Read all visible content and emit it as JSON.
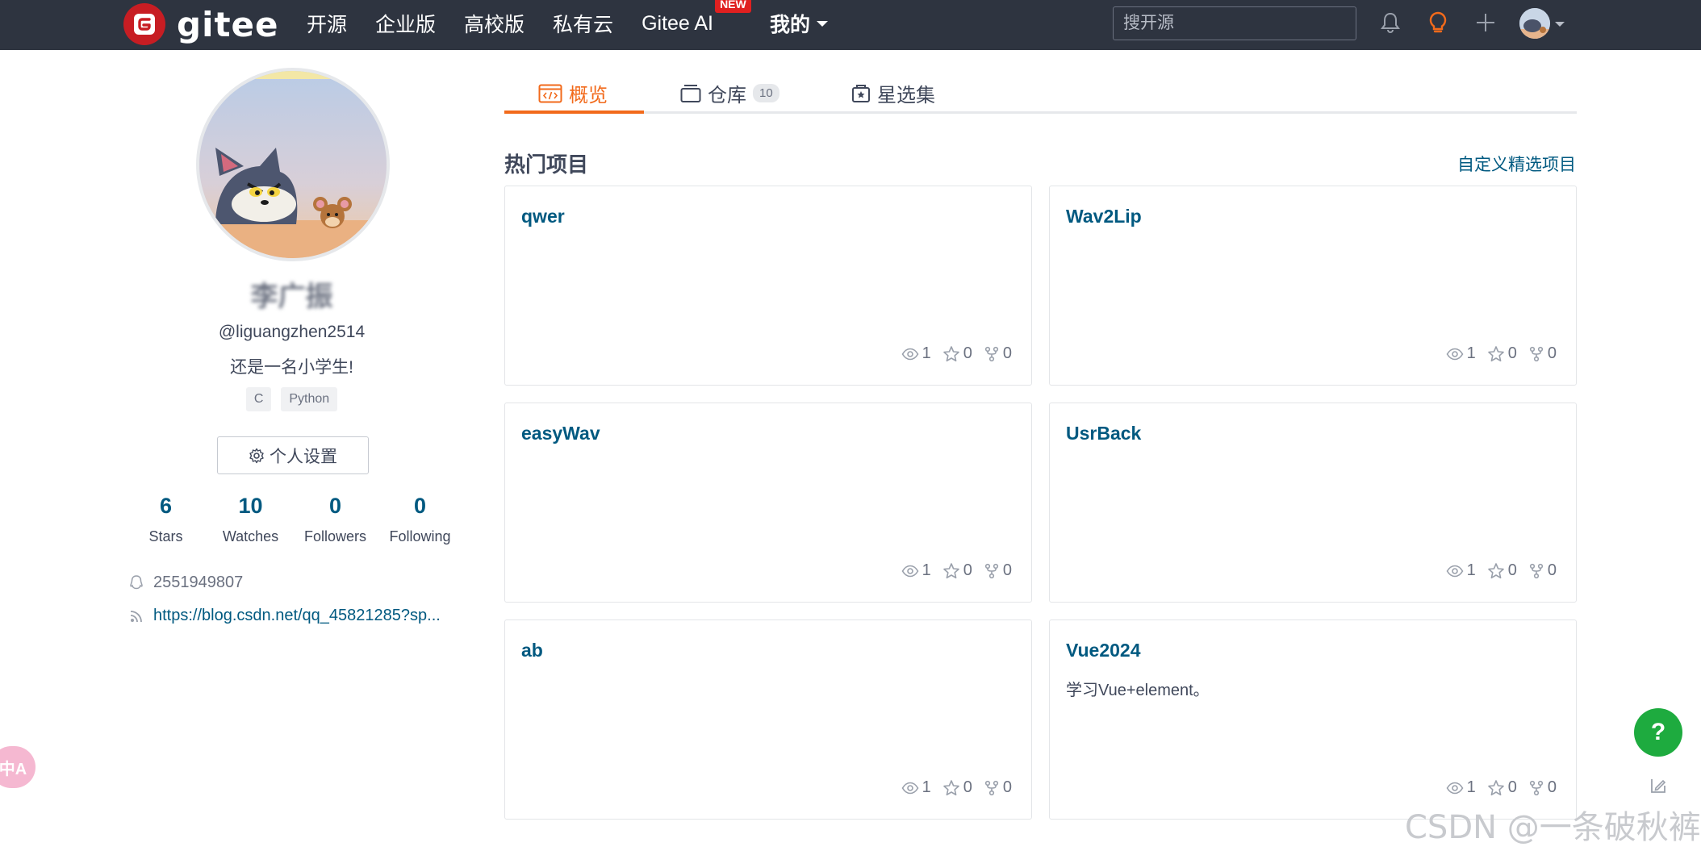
{
  "header": {
    "logo_text": "gitee",
    "nav": {
      "open_source": "开源",
      "enterprise": "企业版",
      "university": "高校版",
      "private_cloud": "私有云",
      "gitee_ai": "Gitee AI",
      "gitee_ai_badge": "NEW",
      "mine": "我的"
    },
    "search_placeholder": "搜开源"
  },
  "profile": {
    "name": "李广振",
    "handle": "@liguangzhen2514",
    "bio": "还是一名小学生!",
    "languages": [
      "C",
      "Python"
    ],
    "settings_label": "个人设置",
    "stats": [
      {
        "num": "6",
        "label": "Stars"
      },
      {
        "num": "10",
        "label": "Watches"
      },
      {
        "num": "0",
        "label": "Followers"
      },
      {
        "num": "0",
        "label": "Following"
      }
    ],
    "qq": "2551949807",
    "blog": "https://blog.csdn.net/qq_45821285?sp..."
  },
  "tabs": {
    "overview": "概览",
    "repos": "仓库",
    "repos_count": "10",
    "starred": "星选集"
  },
  "section": {
    "title": "热门项目",
    "custom_link": "自定义精选项目"
  },
  "projects": [
    {
      "name": "qwer",
      "desc": "",
      "views": "1",
      "stars": "0",
      "forks": "0"
    },
    {
      "name": "Wav2Lip",
      "desc": "",
      "views": "1",
      "stars": "0",
      "forks": "0"
    },
    {
      "name": "easyWav",
      "desc": "",
      "views": "1",
      "stars": "0",
      "forks": "0"
    },
    {
      "name": "UsrBack",
      "desc": "",
      "views": "1",
      "stars": "0",
      "forks": "0"
    },
    {
      "name": "ab",
      "desc": "",
      "views": "1",
      "stars": "0",
      "forks": "0"
    },
    {
      "name": "Vue2024",
      "desc": "学习Vue+element。",
      "views": "1",
      "stars": "0",
      "forks": "0"
    }
  ],
  "floating": {
    "help": "?",
    "translate": "中A"
  },
  "watermark": "CSDN @一条破秋裤",
  "colors": {
    "nav_bg": "#2e3440",
    "brand_red": "#c71d23",
    "accent_orange": "#f26a1b",
    "link_blue": "#005980",
    "help_green": "#1eab3f"
  }
}
